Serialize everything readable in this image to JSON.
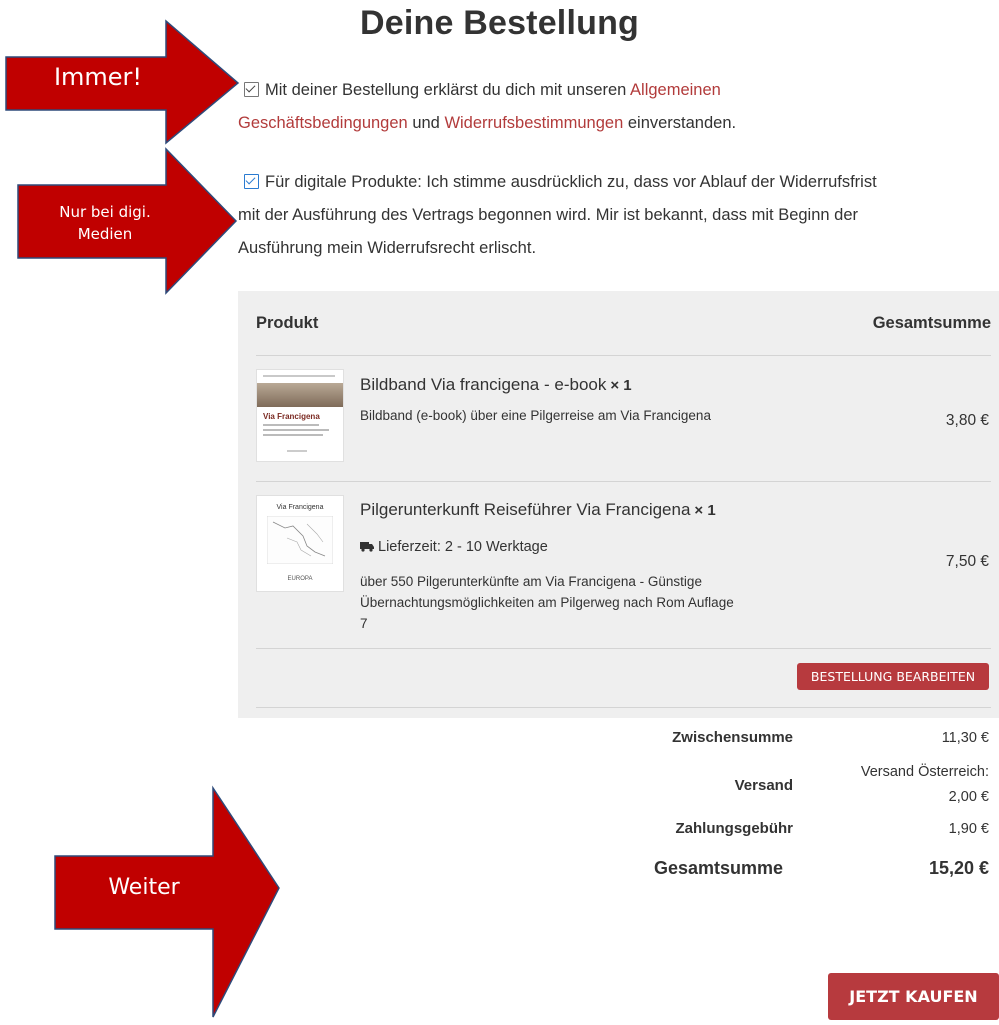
{
  "title": "Deine Bestellung",
  "arrows": {
    "first": "Immer!",
    "second_line1": "Nur bei digi.",
    "second_line2": "Medien",
    "third": "Weiter"
  },
  "terms": {
    "agb_pre": "Mit deiner Bestellung erklärst du dich mit unseren",
    "agb_link1_a": "Allgemeinen",
    "agb_link1_b": "Geschäftsbedingungen",
    "agb_mid": "und",
    "agb_link2": "Widerrufsbestimmungen",
    "agb_post": "einverstanden.",
    "digital_line1": "Für digitale Produkte: Ich stimme ausdrücklich zu, dass vor Ablauf der Widerrufsfrist",
    "digital_line2": "mit der Ausführung des Vertrags begonnen wird. Mir ist bekannt, dass mit Beginn der",
    "digital_line3": "Ausführung mein Widerrufsrecht erlischt."
  },
  "table": {
    "col_product": "Produkt",
    "col_total": "Gesamtsumme",
    "items": [
      {
        "name": "Bildband Via francigena - e-book",
        "qty": "× 1",
        "description": "Bildband (e-book) über eine Pilgerreise am Via Francigena",
        "price": "3,80 €"
      },
      {
        "name": "Pilgerunterkunft Reiseführer Via Francigena",
        "qty": "× 1",
        "delivery": "Lieferzeit: 2 - 10 Werktage",
        "desc_line1": "über 550 Pilgerunterkünfte am Via Francigena - Günstige",
        "desc_line2": "Übernachtungsmöglichkeiten am Pilgerweg nach Rom Auflage",
        "desc_line3": "7",
        "price": "7,50 €"
      }
    ],
    "edit_button": "BESTELLUNG BEARBEITEN"
  },
  "totals": {
    "subtotal_label": "Zwischensumme",
    "subtotal_value": "11,30 €",
    "shipping_label": "Versand",
    "shipping_value_line1": "Versand Österreich:",
    "shipping_value_line2": "2,00 €",
    "fee_label": "Zahlungsgebühr",
    "fee_value": "1,90 €",
    "total_label": "Gesamtsumme",
    "total_value": "15,20 €"
  },
  "buy_button": "JETZT KAUFEN",
  "thumbs": {
    "book1_title": "Via Francigena",
    "book2_title": "Via Francigena",
    "book2_footer": "EUROPA"
  },
  "colors": {
    "accent": "#b73a3e",
    "link": "#b23b3b",
    "arrow_fill": "#c00000",
    "panel_bg": "#efefef"
  }
}
